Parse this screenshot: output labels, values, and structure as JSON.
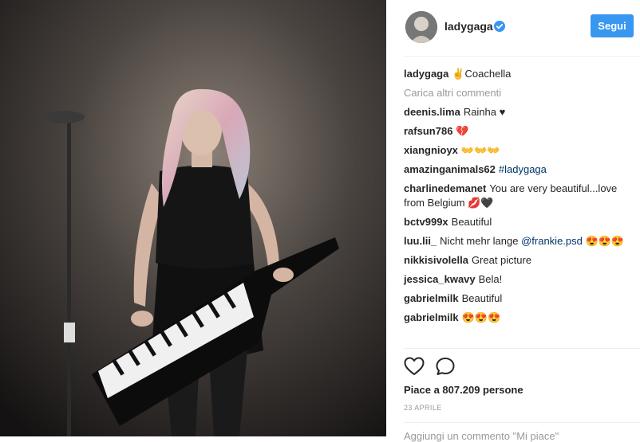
{
  "post": {
    "username": "ladygaga",
    "follow_label": "Segui",
    "caption_user": "ladygaga",
    "caption_text": "✌Coachella",
    "load_more": "Carica altri commenti",
    "likes": "Piace a 807.209 persone",
    "date": "23 APRILE",
    "add_comment_placeholder": "Aggiungi un commento \"Mi piace\""
  },
  "comments": [
    {
      "user": "deenis.lima",
      "text": "Rainha ♥"
    },
    {
      "user": "rafsun786",
      "text": "💔"
    },
    {
      "user": "xiangnioyx",
      "text": "👐👐👐"
    },
    {
      "user": "amazinganimals62",
      "text": "#ladygaga"
    },
    {
      "user": "charlinedemanet",
      "text": "You are very beautiful...love from Belgium 💋🖤"
    },
    {
      "user": "bctv999x",
      "text": "Beautiful"
    },
    {
      "user": "luu.lii_",
      "text": "Nicht mehr lange",
      "mention": "@frankie.psd",
      "after": "😍😍😍"
    },
    {
      "user": "nikkisivolella",
      "text": "Great picture"
    },
    {
      "user": "jessica_kwavy",
      "text": "Bela!"
    },
    {
      "user": "gabrielmilk",
      "text": "Beautiful"
    },
    {
      "user": "gabrielmilk",
      "text": "😍😍😍"
    }
  ],
  "colors": {
    "accent": "#3897f0",
    "verified": "#3897f0",
    "link": "#003569"
  },
  "icons": [
    "verified-badge-icon",
    "heart-icon",
    "comment-icon"
  ]
}
